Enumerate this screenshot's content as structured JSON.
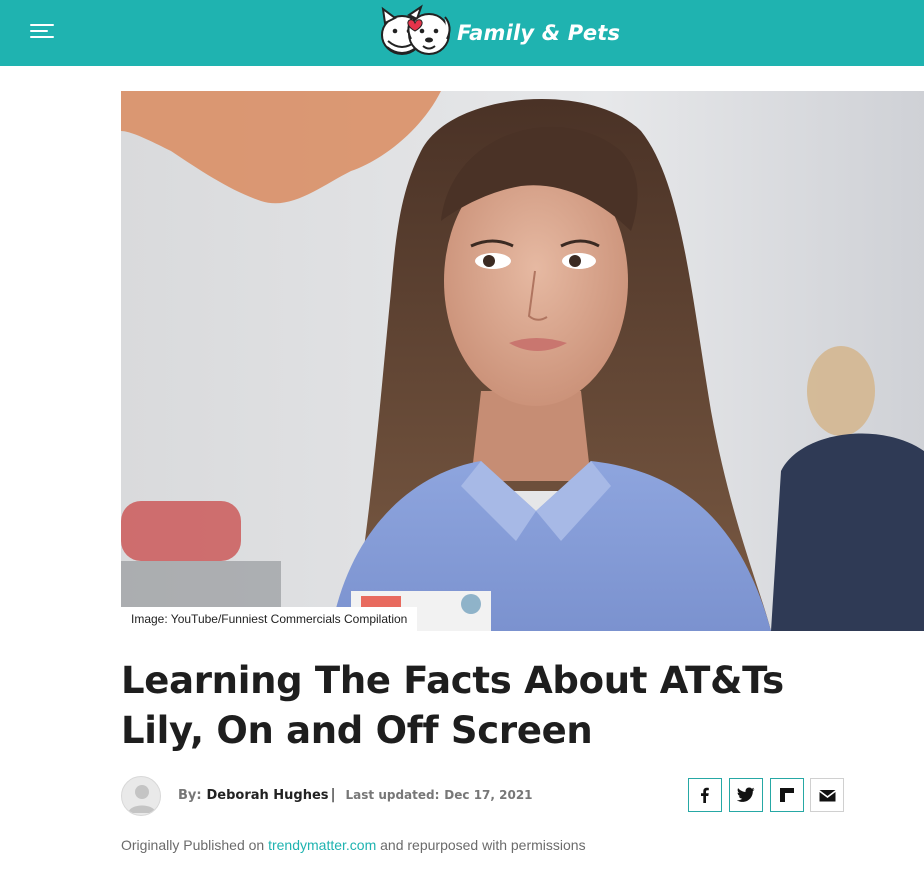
{
  "header": {
    "brand_name": "Family & Pets",
    "brand_color": "#1fb3b0",
    "menu_icon": "hamburger-menu-icon"
  },
  "hero": {
    "caption": "Image: YouTube/Funniest Commercials Compilation"
  },
  "article": {
    "title_line1": "Learning The Facts About AT&Ts",
    "title_line2": "Lily, On and Off Screen"
  },
  "byline": {
    "by_label": "By:",
    "author": "Deborah Hughes",
    "separator": "|",
    "updated_label": "Last updated:",
    "updated_date": "Dec 17, 2021"
  },
  "share": {
    "buttons": [
      {
        "icon": "facebook-icon"
      },
      {
        "icon": "twitter-icon"
      },
      {
        "icon": "flipboard-icon"
      },
      {
        "icon": "email-icon"
      }
    ]
  },
  "origin": {
    "prefix": "Originally Published on",
    "link": "trendymatter.com",
    "suffix": "and repurposed with permissions"
  }
}
